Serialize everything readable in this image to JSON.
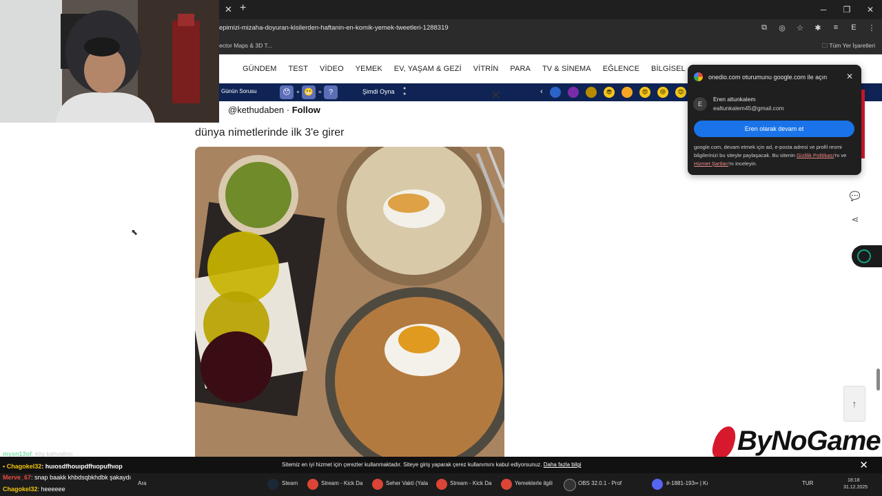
{
  "browser": {
    "url": "epimizi-mizaha-doyuran-kisilerden-haftanin-en-komik-yemek-tweetleri-1288319",
    "bookmark_left": "ector Maps & 3D T...",
    "bookmark_right": "Tüm Yer İşaretleri",
    "profile_initial": "E"
  },
  "site": {
    "nav": [
      "GÜNDEM",
      "TEST",
      "VİDEO",
      "YEMEK",
      "EV, YAŞAM & GEZİ",
      "VİTRİN",
      "PARA",
      "TV & SİNEMA",
      "EĞLENCE",
      "BİLGİSEL"
    ],
    "quiz_label": "Günün Sorusu",
    "play_label": "Şimdi Oyna"
  },
  "tweet": {
    "handle": "@kethudaben",
    "follow": "Follow",
    "text": "dünya nimetlerinde ilk 3'e girer"
  },
  "google_popup": {
    "title": "onedio.com oturumunu google.com ile açın",
    "avatar": "E",
    "name": "Eren altunkalem",
    "email": "ealtunkalem45@gmail.com",
    "continue": "Eren olarak devam et",
    "legal_1": "google.com, devam etmek için ad, e-posta adresi ve profil resmi bilgilerinizi bu siteyle paylaşacak. Bu sitenin ",
    "legal_link1": "Gizlilik Politikası",
    "legal_2": "'nı ve ",
    "legal_link2": "Hizmet Şartları",
    "legal_3": "'nı inceleyin."
  },
  "cookie": {
    "text": "Sitemiz en iyi hizmet için çerezler kullanmaktadır. Siteye giriş yaparak çerez kullanımını kabul ediyorsunuz. ",
    "link": "Daha fazla bilgi"
  },
  "chat": [
    {
      "user": "mysn13of",
      "msg": ": köy kahvaltısı",
      "color": "#2ecc71"
    },
    {
      "user": "Chagokel32",
      "msg": ": huıosdfhouıpdfhıopufhıop",
      "color": "#f1c40f"
    },
    {
      "user": "Merve_67",
      "msg": ": snap baakk khbdsqbkhdbk şakaydı",
      "color": "#e74c3c"
    },
    {
      "user": "Chagokel32",
      "msg": ": heeeeee",
      "color": "#f1c40f"
    }
  ],
  "taskbar": {
    "search": "Ara",
    "items": [
      "Steam",
      "Stream - Kick Da",
      "Seher Vakti (Yala",
      "Stream - Kick Da",
      "Yemeklerle ilgili",
      "OBS 32.0.1 - Prof",
      "#-1881-193∞ | Kı"
    ],
    "lang": "TUR",
    "time": "18:18",
    "date": "31.12.2025"
  },
  "watermark": "ByNoGame",
  "colors": {
    "nav_dark": "#0f2454",
    "google_blue": "#1a73e8",
    "brand_red": "#d7192d"
  }
}
